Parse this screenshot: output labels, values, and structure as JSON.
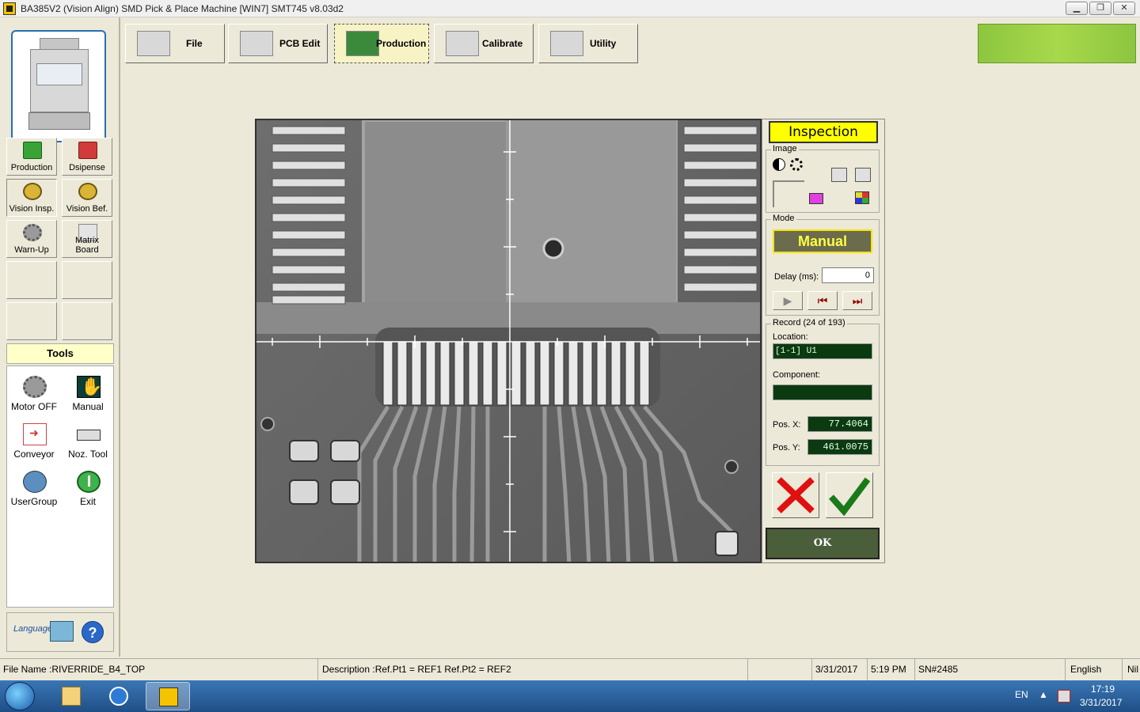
{
  "window": {
    "title": "BA385V2 (Vision Align) SMD Pick & Place Machine   [WIN7]     SMT745  v8.03d2",
    "min_label": "▁",
    "restore_label": "❐",
    "close_label": "✕"
  },
  "toolbar": {
    "buttons": [
      {
        "label": "File"
      },
      {
        "label": "PCB Edit"
      },
      {
        "label": "Production"
      },
      {
        "label": "Calibrate"
      },
      {
        "label": "Utility"
      }
    ]
  },
  "left": {
    "grid": [
      {
        "label": "Production"
      },
      {
        "label": "Dsipense"
      },
      {
        "label": "Vision Insp."
      },
      {
        "label": "Vision Bef."
      },
      {
        "label": "Warn-Up"
      },
      {
        "label": "Matrix Board"
      }
    ],
    "tools_title": "Tools",
    "tools": [
      {
        "label": "Motor OFF"
      },
      {
        "label": "Manual"
      },
      {
        "label": "Conveyor"
      },
      {
        "label": "Noz. Tool"
      },
      {
        "label": "UserGroup"
      },
      {
        "label": "Exit"
      }
    ],
    "language_label": "Language",
    "help_label": "?"
  },
  "inspection": {
    "title": "Inspection",
    "image_group": "Image",
    "mode_group": "Mode",
    "mode_value": "Manual",
    "delay_label": "Delay (ms):",
    "delay_value": "0",
    "record_group": "Record (24 of 193)",
    "location_label": "Location:",
    "location_value": "[1-1] U1",
    "component_label": "Component:",
    "component_value": "",
    "posx_label": "Pos. X:",
    "posx_value": "77.4064",
    "posy_label": "Pos. Y:",
    "posy_value": "461.0075",
    "ok_label": "OK"
  },
  "status": {
    "file_name": "File Name :RIVERRIDE_B4_TOP",
    "description": "Description :Ref.Pt1 = REF1     Ref.Pt2 = REF2",
    "date": "3/31/2017",
    "time": "5:19 PM",
    "serial": "SN#2485",
    "language": "English",
    "extra": "Nil"
  },
  "taskbar": {
    "lang": "EN",
    "clock_time": "17:19",
    "clock_date": "3/31/2017"
  },
  "colors": {
    "inspection_title_bg": "#ffff00",
    "mode_bg": "#6b6b4e",
    "mode_text": "#ffff40",
    "status_indicator": "#8cc63f",
    "readout_bg": "#0b3a10"
  }
}
